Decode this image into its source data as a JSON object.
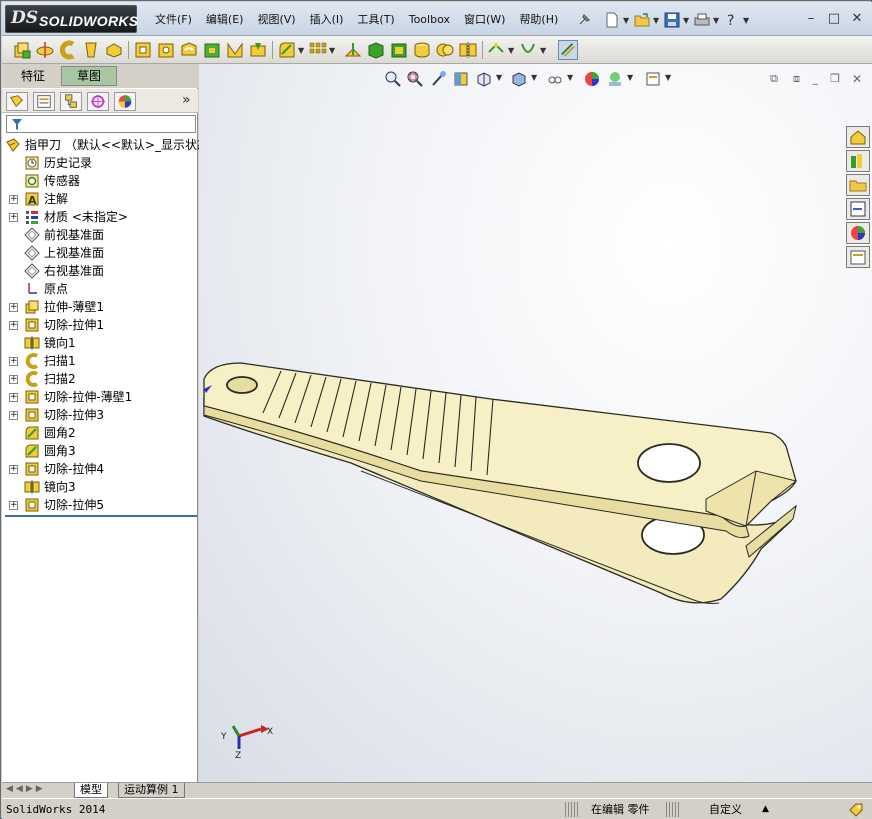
{
  "app": {
    "brand_prefix": "DS",
    "brand": "SOLIDWORKS"
  },
  "menu": [
    "文件(F)",
    "编辑(E)",
    "视图(V)",
    "插入(I)",
    "工具(T)",
    "Toolbox",
    "窗口(W)",
    "帮助(H)"
  ],
  "manager_tabs": {
    "features": "特征",
    "sketch": "草图"
  },
  "tree": {
    "root": "指甲刀 （默认<<默认>_显示状态",
    "items": [
      {
        "label": "历史记录",
        "icon": "history-icon",
        "expandable": false
      },
      {
        "label": "传感器",
        "icon": "sensor-icon",
        "expandable": false
      },
      {
        "label": "注解",
        "icon": "annotation-icon",
        "expandable": true
      },
      {
        "label": "材质 <未指定>",
        "icon": "material-icon",
        "expandable": true
      },
      {
        "label": "前视基准面",
        "icon": "plane-icon",
        "expandable": false
      },
      {
        "label": "上视基准面",
        "icon": "plane-icon",
        "expandable": false
      },
      {
        "label": "右视基准面",
        "icon": "plane-icon",
        "expandable": false
      },
      {
        "label": "原点",
        "icon": "origin-icon",
        "expandable": false
      },
      {
        "label": "拉伸-薄壁1",
        "icon": "extrude-icon",
        "expandable": true
      },
      {
        "label": "切除-拉伸1",
        "icon": "cut-extrude-icon",
        "expandable": true
      },
      {
        "label": "镜向1",
        "icon": "mirror-icon",
        "expandable": false
      },
      {
        "label": "扫描1",
        "icon": "sweep-icon",
        "expandable": true
      },
      {
        "label": "扫描2",
        "icon": "sweep-icon",
        "expandable": true
      },
      {
        "label": "切除-拉伸-薄壁1",
        "icon": "cut-extrude-icon",
        "expandable": true
      },
      {
        "label": "切除-拉伸3",
        "icon": "cut-extrude-icon",
        "expandable": true
      },
      {
        "label": "圆角2",
        "icon": "fillet-icon",
        "expandable": false
      },
      {
        "label": "圆角3",
        "icon": "fillet-icon",
        "expandable": false
      },
      {
        "label": "切除-拉伸4",
        "icon": "cut-extrude-icon",
        "expandable": true
      },
      {
        "label": "镜向3",
        "icon": "mirror-icon",
        "expandable": false
      },
      {
        "label": "切除-拉伸5",
        "icon": "cut-extrude-icon",
        "expandable": true
      }
    ]
  },
  "bottom_tabs": {
    "model": "模型",
    "motion": "运动算例 1"
  },
  "status": {
    "version": "SolidWorks 2014",
    "mode": "在编辑 零件",
    "units": "自定义"
  },
  "triad": {
    "x": "X",
    "y": "Y",
    "z": "Z"
  },
  "colors": {
    "part_fill": "#f6f0c6",
    "part_shade": "#e8dca0",
    "edge": "#2a2a20",
    "selection_bar": "#3a6ea5"
  }
}
